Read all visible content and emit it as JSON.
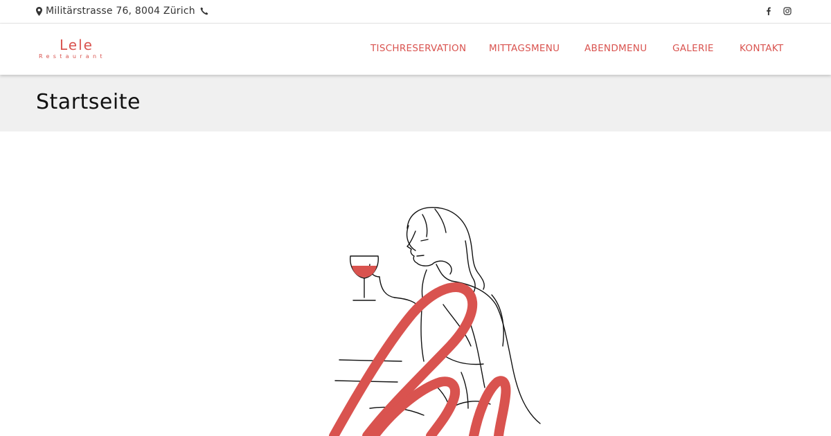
{
  "topbar": {
    "address": "Militärstrasse 76, 8004 Zürich",
    "icons": [
      "map-marker-icon",
      "phone-icon",
      "facebook-icon",
      "instagram-icon"
    ]
  },
  "header": {
    "logo": {
      "name": "Lele",
      "subtitle": "Restaurant"
    },
    "nav": [
      {
        "label": "TISCHRESERVATION"
      },
      {
        "label": "MITTAGSMENU"
      },
      {
        "label": "ABENDMENU"
      },
      {
        "label": "GALERIE"
      },
      {
        "label": "KONTAKT"
      }
    ]
  },
  "page": {
    "title": "Startseite"
  },
  "colors": {
    "accent": "#d9534f",
    "band": "#f0f0f0",
    "text": "#222222"
  }
}
